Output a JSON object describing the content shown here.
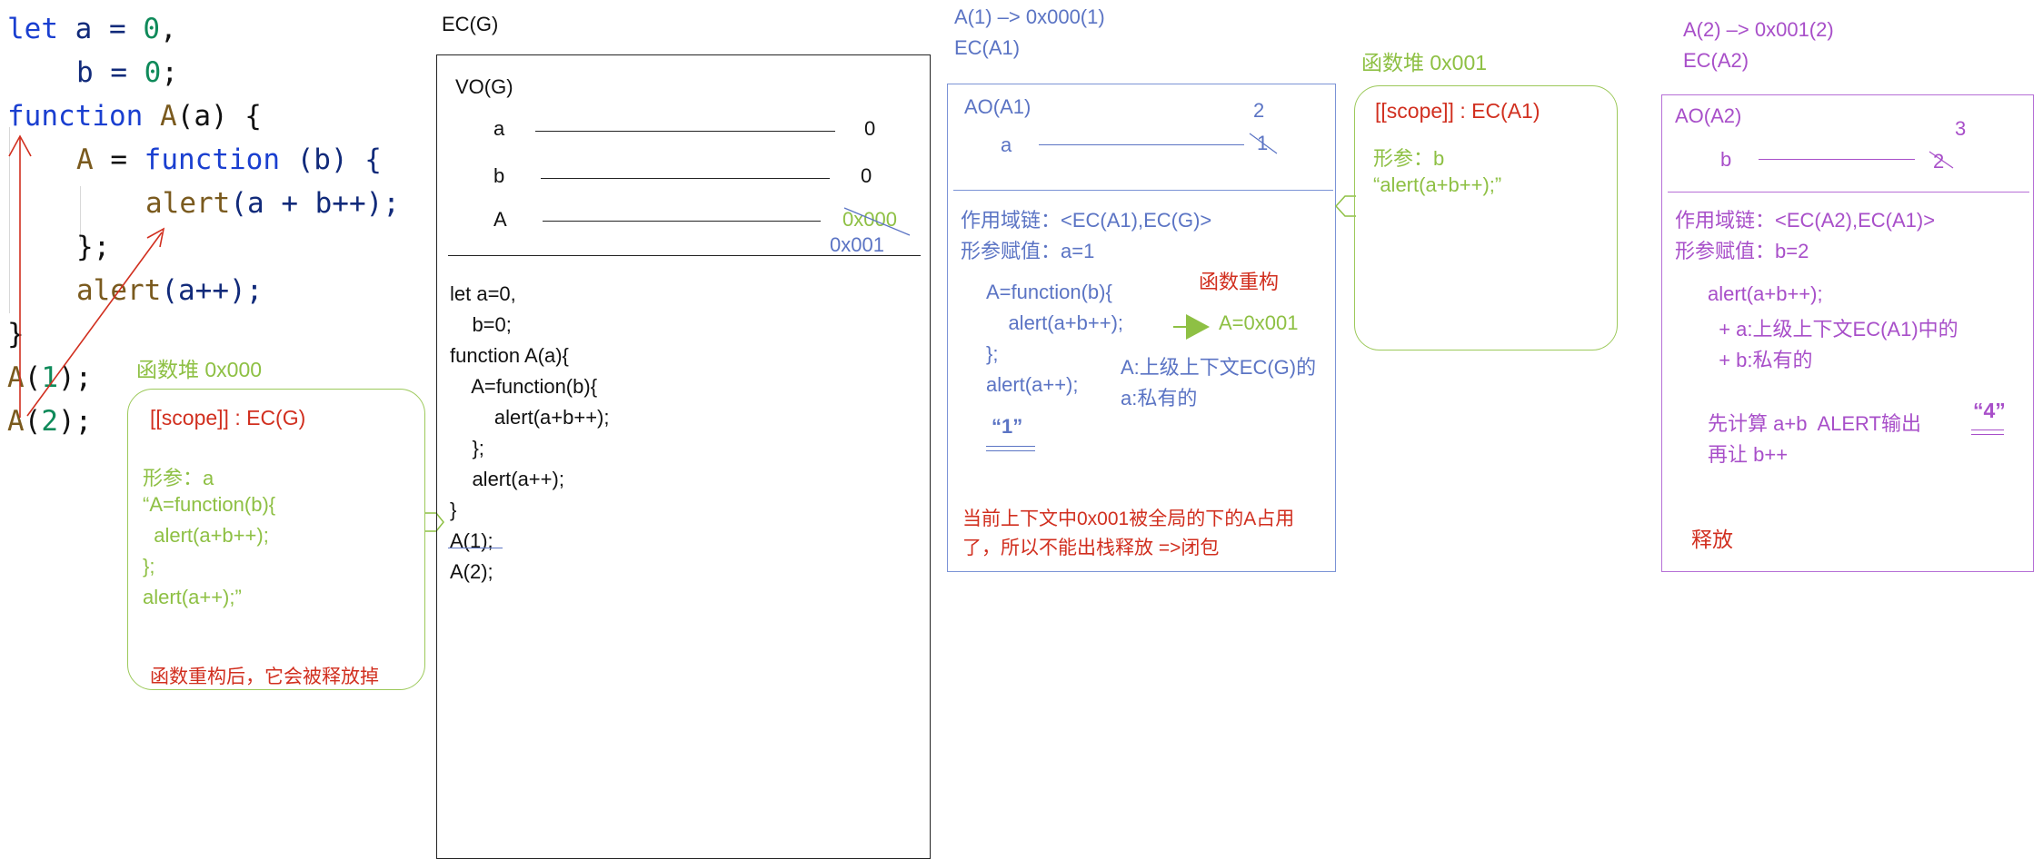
{
  "code_lines": [
    [
      "let",
      " a = ",
      "0",
      ","
    ],
    [
      "    b = ",
      "0",
      ";"
    ],
    [
      "function",
      " ",
      "A",
      "(a) {"
    ],
    [
      "    ",
      "A",
      " = ",
      "function",
      " (b) {"
    ],
    [
      "        ",
      "alert",
      "(a + b++);"
    ],
    [
      "    };"
    ],
    [
      "    ",
      "alert",
      "(a++);"
    ],
    [
      "}"
    ],
    [
      "A",
      "(",
      "1",
      ");"
    ],
    [
      "A",
      "(",
      "2",
      ");"
    ]
  ],
  "code": {
    "l1_kw": "let",
    "l1_rest": " a = ",
    "l1_num": "0",
    "l1_end": ",",
    "l2_rest": "b = ",
    "l2_num": "0",
    "l2_end": ";",
    "l3_kw": "function",
    "l3_fn": "A",
    "l3_rest": "(a) {",
    "l4_fn": "A",
    "l4_eq": " = ",
    "l4_kw": "function",
    "l4_rest": " (b) {",
    "l5_fn": "alert",
    "l5_rest": "(a + b++);",
    "l6": "};",
    "l7_fn": "alert",
    "l7_rest": "(a++);",
    "l8": "}",
    "l9_fn": "A",
    "l9_open": "(",
    "l9_num": "1",
    "l9_end": ");",
    "l10_fn": "A",
    "l10_open": "(",
    "l10_num": "2",
    "l10_end": ");"
  },
  "heap0": {
    "title": "函数堆 0x000",
    "scope": "[[scope]] : EC(G)",
    "param": "形参：a",
    "body1": "“A=function(b){",
    "body2": "  alert(a+b++);",
    "body3": "};",
    "body4": "alert(a++);”",
    "note": "函数重构后，它会被释放掉"
  },
  "ecg": {
    "title": "EC(G)",
    "vo": "VO(G)",
    "vars": [
      {
        "name": "a",
        "value": "0"
      },
      {
        "name": "b",
        "value": "0"
      },
      {
        "name": "A",
        "value": "0x000"
      }
    ],
    "a_new": "0x001",
    "code": [
      "let a=0,",
      "    b=0;",
      "function A(a){",
      "    A=function(b){",
      "        alert(a+b++);",
      "    };",
      "    alert(a++);",
      "}",
      "A(1);",
      "A(2);"
    ]
  },
  "eca1": {
    "header1": "A(1) –> 0x000(1)",
    "header2": "EC(A1)",
    "ao": "AO(A1)",
    "var_a": "a",
    "a_old": "1",
    "a_new": "2",
    "chain": "作用域链：<EC(A1),EC(G)>",
    "assign": "形参赋值：a=1",
    "code1": "A=function(b){",
    "code2": "    alert(a+b++);",
    "code3": "};",
    "code4": "alert(a++);",
    "reconstruct": "函数重构",
    "a_assign": "A=0x001",
    "note1": "A:上级上下文EC(G)的",
    "note2": "a:私有的",
    "output": "“1”",
    "closure1": "当前上下文中0x001被全局的下的A占用",
    "closure2": "了，所以不能出栈释放 =>闭包"
  },
  "heap1": {
    "title": "函数堆 0x001",
    "scope": "[[scope]] : EC(A1)",
    "param": "形参：b",
    "body": "“alert(a+b++);”"
  },
  "eca2": {
    "header1": "A(2) –> 0x001(2)",
    "header2": "EC(A2)",
    "ao": "AO(A2)",
    "var_b": "b",
    "b_old": "2",
    "b_new": "3",
    "chain": "作用域链：<EC(A2),EC(A1)>",
    "assign": "形参赋值：b=2",
    "line1": "alert(a+b++);",
    "line2": "  + a:上级上下文EC(A1)中的",
    "line3": "  + b:私有的",
    "line4": "先计算 a+b  ALERT输出",
    "output": "“4”",
    "line5": "再让 b++",
    "release": "释放"
  },
  "colors": {
    "green": "#8ec044",
    "blue": "#5b74c4",
    "purple": "#a84fc9",
    "red": "#d12f1f",
    "dark": "#111111"
  }
}
